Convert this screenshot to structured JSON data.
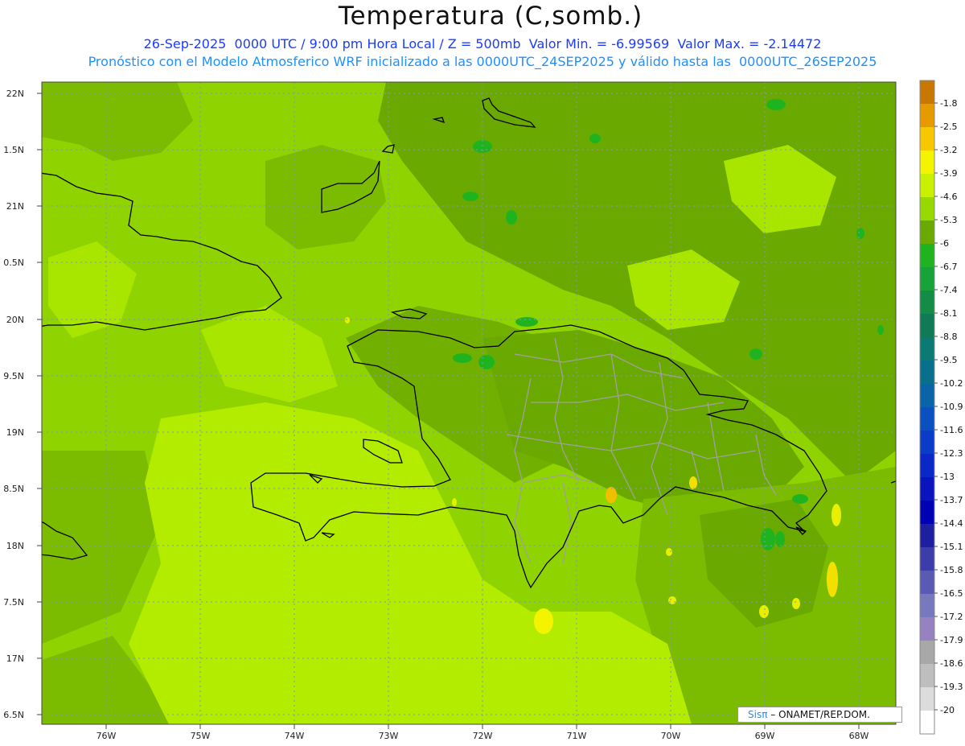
{
  "header": {
    "title": "Temperatura (C,somb.)",
    "line1": "26-Sep-2025  0000 UTC / 9:00 pm Hora Local / Z = 500mb  Valor Min. = -6.99569  Valor Max. = -2.14472",
    "line2": "Pronóstico con el Modelo Atmosferico WRF inicializado a las 0000UTC_24SEP2025 y válido hasta las  0000UTC_26SEP2025"
  },
  "axes": {
    "lat_labels": [
      "22N",
      "1.5N",
      "21N",
      "0.5N",
      "20N",
      "9.5N",
      "19N",
      "8.5N",
      "18N",
      "7.5N",
      "17N",
      "6.5N"
    ],
    "lon_labels": [
      "76W",
      "75W",
      "74W",
      "73W",
      "72W",
      "71W",
      "70W",
      "69W",
      "68W"
    ]
  },
  "legend": {
    "levels": [
      {
        "label": "-1.8",
        "color": "#c87800"
      },
      {
        "label": "-2.5",
        "color": "#e69a00"
      },
      {
        "label": "-3.2",
        "color": "#f7c800"
      },
      {
        "label": "-3.9",
        "color": "#f4f400"
      },
      {
        "label": "-4.6",
        "color": "#c8f000"
      },
      {
        "label": "-5.3",
        "color": "#96d800"
      },
      {
        "label": "-6",
        "color": "#6aaa00"
      },
      {
        "label": "-6.7",
        "color": "#1fb41f"
      },
      {
        "label": "-7.4",
        "color": "#17a23a"
      },
      {
        "label": "-8.1",
        "color": "#128c46"
      },
      {
        "label": "-8.8",
        "color": "#0f7a55"
      },
      {
        "label": "-9.5",
        "color": "#0a7a72"
      },
      {
        "label": "-10.2",
        "color": "#08708c"
      },
      {
        "label": "-10.9",
        "color": "#0a64a8"
      },
      {
        "label": "-11.6",
        "color": "#0a50c0"
      },
      {
        "label": "-12.3",
        "color": "#0a3cc8"
      },
      {
        "label": "-13",
        "color": "#0a28c8"
      },
      {
        "label": "-13.7",
        "color": "#0a14be"
      },
      {
        "label": "-14.4",
        "color": "#0000b4"
      },
      {
        "label": "-15.1",
        "color": "#1e1ea0"
      },
      {
        "label": "-15.8",
        "color": "#3c3caa"
      },
      {
        "label": "-16.5",
        "color": "#5a5ab4"
      },
      {
        "label": "-17.2",
        "color": "#7878be"
      },
      {
        "label": "-17.9",
        "color": "#9682c0"
      },
      {
        "label": "-18.6",
        "color": "#a8a8a8"
      },
      {
        "label": "-19.3",
        "color": "#bebebe"
      },
      {
        "label": "-20",
        "color": "#dcdcdc"
      },
      {
        "label": "",
        "color": "#ffffff"
      }
    ]
  },
  "credit": {
    "brand": "Sisπ",
    "text": "– ONAMET/REP.DOM."
  },
  "colors": {
    "field_base": "#8fd400",
    "field_dark": "#6aaa00",
    "field_light": "#c8f000",
    "field_yellow": "#f4f400",
    "field_green": "#1fb41f",
    "coast": "#000000",
    "province_borders": "#a0a0a0",
    "grid": "#8c8cd2"
  }
}
